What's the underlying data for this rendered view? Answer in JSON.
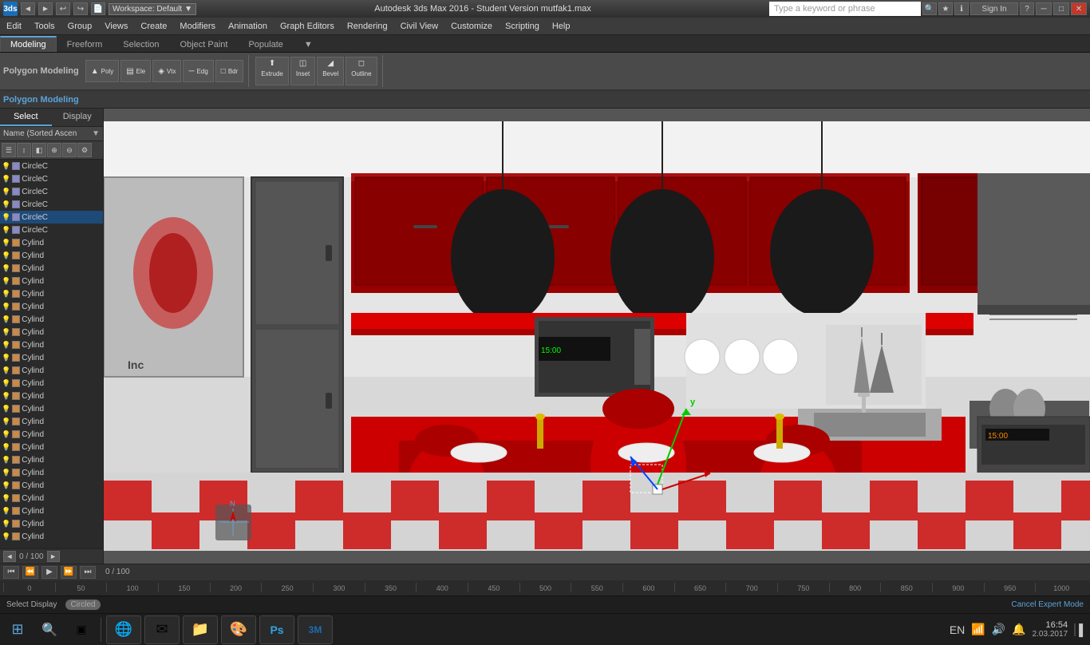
{
  "titlebar": {
    "logo": "3ds",
    "nav_back": "◄",
    "nav_forward": "►",
    "workspace_label": "Workspace: Default",
    "title": "Autodesk 3ds Max 2016 - Student Version    mutfak1.max",
    "search_placeholder": "Type a keyword or phrase",
    "btn_minimize": "─",
    "btn_maximize": "□",
    "btn_close": "✕",
    "btn_help": "?",
    "btn_signin": "Sign In"
  },
  "menubar": {
    "items": [
      "Edit",
      "Tools",
      "Group",
      "Views",
      "Create",
      "Modifiers",
      "Animation",
      "Graph Editors",
      "Rendering",
      "Civil View",
      "Customize",
      "Scripting",
      "Help"
    ]
  },
  "ribbon": {
    "tabs": [
      "Modeling",
      "Freeform",
      "Selection",
      "Object Paint",
      "Populate",
      "▼"
    ],
    "active_tab": "Modeling",
    "sub_label": "Polygon Modeling",
    "panel_tabs": [
      "Select",
      "Display"
    ]
  },
  "left_panel": {
    "header": "Name (Sorted Ascen",
    "icons": [
      "▼",
      "☰",
      "✦",
      "⊕",
      "✎",
      "◈",
      "⋮"
    ],
    "objects": [
      {
        "name": "CircleC",
        "type": "circle",
        "selected": false
      },
      {
        "name": "CircleC",
        "type": "circle",
        "selected": false
      },
      {
        "name": "CircleC",
        "type": "circle",
        "selected": false
      },
      {
        "name": "CircleC",
        "type": "circle",
        "selected": false
      },
      {
        "name": "CircleC",
        "type": "circle",
        "selected": true
      },
      {
        "name": "CircleC",
        "type": "circle",
        "selected": false
      },
      {
        "name": "Cylind",
        "type": "cylinder",
        "selected": false
      },
      {
        "name": "Cylind",
        "type": "cylinder",
        "selected": false
      },
      {
        "name": "Cylind",
        "type": "cylinder",
        "selected": false
      },
      {
        "name": "Cylind",
        "type": "cylinder",
        "selected": false
      },
      {
        "name": "Cylind",
        "type": "cylinder",
        "selected": false
      },
      {
        "name": "Cylind",
        "type": "cylinder",
        "selected": false
      },
      {
        "name": "Cylind",
        "type": "cylinder",
        "selected": false
      },
      {
        "name": "Cylind",
        "type": "cylinder",
        "selected": false
      },
      {
        "name": "Cylind",
        "type": "cylinder",
        "selected": false
      },
      {
        "name": "Cylind",
        "type": "cylinder",
        "selected": false
      },
      {
        "name": "Cylind",
        "type": "cylinder",
        "selected": false
      },
      {
        "name": "Cylind",
        "type": "cylinder",
        "selected": false
      },
      {
        "name": "Cylind",
        "type": "cylinder",
        "selected": false
      },
      {
        "name": "Cylind",
        "type": "cylinder",
        "selected": false
      },
      {
        "name": "Cylind",
        "type": "cylinder",
        "selected": false
      },
      {
        "name": "Cylind",
        "type": "cylinder",
        "selected": false
      },
      {
        "name": "Cylind",
        "type": "cylinder",
        "selected": false
      },
      {
        "name": "Cylind",
        "type": "cylinder",
        "selected": false
      },
      {
        "name": "Cylind",
        "type": "cylinder",
        "selected": false
      },
      {
        "name": "Cylind",
        "type": "cylinder",
        "selected": false
      },
      {
        "name": "Cylind",
        "type": "cylinder",
        "selected": false
      },
      {
        "name": "Cylind",
        "type": "cylinder",
        "selected": false
      },
      {
        "name": "Cylind",
        "type": "cylinder",
        "selected": false
      },
      {
        "name": "Cylind",
        "type": "cylinder",
        "selected": false
      }
    ],
    "footer_progress": "0 / 100",
    "select_label": "Select",
    "display_label": "Display"
  },
  "viewport": {
    "label": ""
  },
  "timeline": {
    "progress": "0 / 100",
    "ruler_marks": [
      "0",
      "50",
      "100",
      "150",
      "200",
      "250",
      "300",
      "350",
      "400",
      "450",
      "500",
      "550",
      "600",
      "650",
      "700",
      "750",
      "800",
      "850",
      "900",
      "950",
      "1000"
    ]
  },
  "statusbar": {
    "left": "Select Display",
    "right": "Cancel Expert Mode",
    "circled": "Circled"
  },
  "taskbar": {
    "start_label": "⊞",
    "search_label": "🔍",
    "task_view": "▣",
    "apps": [
      "🌐",
      "✉",
      "📁",
      "🎨",
      "Ps",
      "3ds"
    ],
    "clock": "16:54",
    "date": "2.03.2017",
    "notifications": "🔔",
    "volume": "🔊",
    "network": "📶",
    "language": "EN"
  },
  "colors": {
    "accent_blue": "#5ba3d9",
    "red_dark": "#8b0000",
    "red_mid": "#cc0000",
    "bg_dark": "#1e1e1e",
    "bg_mid": "#2e2e2e",
    "bg_panel": "#3d3d3d"
  }
}
